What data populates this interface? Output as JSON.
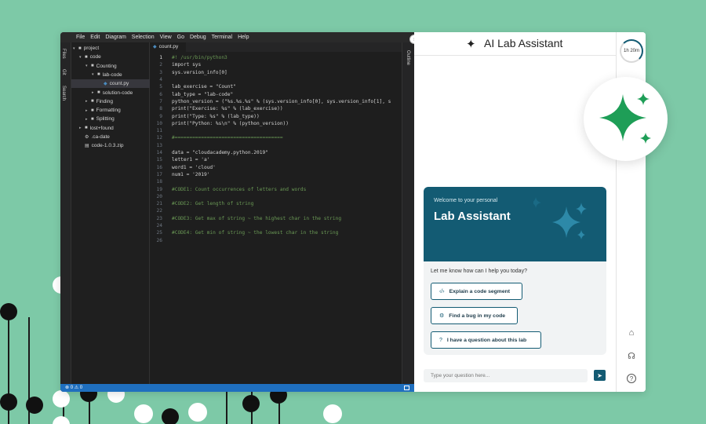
{
  "menubar": [
    "File",
    "Edit",
    "Diagram",
    "Selection",
    "View",
    "Go",
    "Debug",
    "Terminal",
    "Help"
  ],
  "activity_bar": {
    "files": "Files",
    "git": "Git",
    "search": "Search"
  },
  "explorer": [
    {
      "label": "project",
      "depth": 0,
      "arrow": "▾",
      "type": "folder"
    },
    {
      "label": "code",
      "depth": 1,
      "arrow": "▾",
      "type": "folder"
    },
    {
      "label": "Counting",
      "depth": 2,
      "arrow": "▾",
      "type": "folder"
    },
    {
      "label": "lab-code",
      "depth": 3,
      "arrow": "▾",
      "type": "folder"
    },
    {
      "label": "count.py",
      "depth": 4,
      "arrow": "",
      "type": "file-py",
      "selected": true
    },
    {
      "label": "solution-code",
      "depth": 3,
      "arrow": "▸",
      "type": "folder"
    },
    {
      "label": "Finding",
      "depth": 2,
      "arrow": "▸",
      "type": "folder"
    },
    {
      "label": "Formatting",
      "depth": 2,
      "arrow": "▸",
      "type": "folder"
    },
    {
      "label": "Splitting",
      "depth": 2,
      "arrow": "▸",
      "type": "folder"
    },
    {
      "label": "lost+found",
      "depth": 1,
      "arrow": "▸",
      "type": "folder"
    },
    {
      "label": ".ca-date",
      "depth": 1,
      "arrow": "",
      "type": "file-gear"
    },
    {
      "label": "code-1.0.3.zip",
      "depth": 1,
      "arrow": "",
      "type": "file-zip"
    }
  ],
  "editor": {
    "tab_label": "count.py",
    "active_line": 1,
    "lines": [
      {
        "n": "1",
        "text": "#! /usr/bin/python3",
        "kind": "comment"
      },
      {
        "n": "2",
        "text": "import sys",
        "kind": "code"
      },
      {
        "n": "3",
        "text": "sys.version_info[0]",
        "kind": "code"
      },
      {
        "n": "4",
        "text": "",
        "kind": "code"
      },
      {
        "n": "5",
        "text": "lab_exercise = \"Count\"",
        "kind": "code"
      },
      {
        "n": "6",
        "text": "lab_type = \"lab-code\"",
        "kind": "code"
      },
      {
        "n": "7",
        "text": "python_version = (\"%s.%s.%s\" % (sys.version_info[0], sys.version_info[1], s",
        "kind": "code"
      },
      {
        "n": "8",
        "text": "print(\"Exercise: %s\" % (lab_exercise))",
        "kind": "code"
      },
      {
        "n": "9",
        "text": "print(\"Type: %s\" % (lab_type))",
        "kind": "code"
      },
      {
        "n": "10",
        "text": "print(\"Python: %s\\n\" % (python_version))",
        "kind": "code"
      },
      {
        "n": "11",
        "text": "",
        "kind": "code"
      },
      {
        "n": "12",
        "text": "#=====================================",
        "kind": "comment"
      },
      {
        "n": "13",
        "text": "",
        "kind": "code"
      },
      {
        "n": "14",
        "text": "data = \"cloudacademy.python.2019\"",
        "kind": "code"
      },
      {
        "n": "15",
        "text": "letter1 = 'a'",
        "kind": "code"
      },
      {
        "n": "16",
        "text": "word1 = 'cloud'",
        "kind": "code"
      },
      {
        "n": "17",
        "text": "num1 = '2019'",
        "kind": "code"
      },
      {
        "n": "18",
        "text": "",
        "kind": "code"
      },
      {
        "n": "19",
        "text": "#CODE1: Count occurrences of letters and words",
        "kind": "comment"
      },
      {
        "n": "20",
        "text": "",
        "kind": "code"
      },
      {
        "n": "21",
        "text": "#CODE2: Get length of string",
        "kind": "comment"
      },
      {
        "n": "22",
        "text": "",
        "kind": "code"
      },
      {
        "n": "23",
        "text": "#CODE3: Get max of string ~ the highest char in the string",
        "kind": "comment"
      },
      {
        "n": "24",
        "text": "",
        "kind": "code"
      },
      {
        "n": "25",
        "text": "#CODE4: Get min of string ~ the lowest char in the string",
        "kind": "comment"
      },
      {
        "n": "26",
        "text": "",
        "kind": "code"
      }
    ]
  },
  "outline_label": "Outline",
  "status": {
    "text": "⊗ 0 ⚠ 0"
  },
  "assistant": {
    "title": "AI Lab Assistant",
    "welcome_small": "Welcome to your personal",
    "welcome_big": "Lab Assistant",
    "prompt": "Let me know how can I help you today?",
    "actions": [
      {
        "icon": "‹/›",
        "label": "Explain a code segment"
      },
      {
        "icon": "⚙",
        "label": "Find a bug in my code"
      },
      {
        "icon": "?",
        "label": "I have a question about this lab"
      }
    ],
    "input_placeholder": "Type your question here...",
    "send_icon": "➤"
  },
  "rail": {
    "timer": "1h 20m",
    "home_icon": "⌂",
    "support_icon": "☊",
    "help_icon": "?"
  },
  "colors": {
    "accent": "#135b73",
    "background": "#7dc9a7",
    "gemini_green": "#1e9e57",
    "status_blue": "#1f6fbf"
  }
}
